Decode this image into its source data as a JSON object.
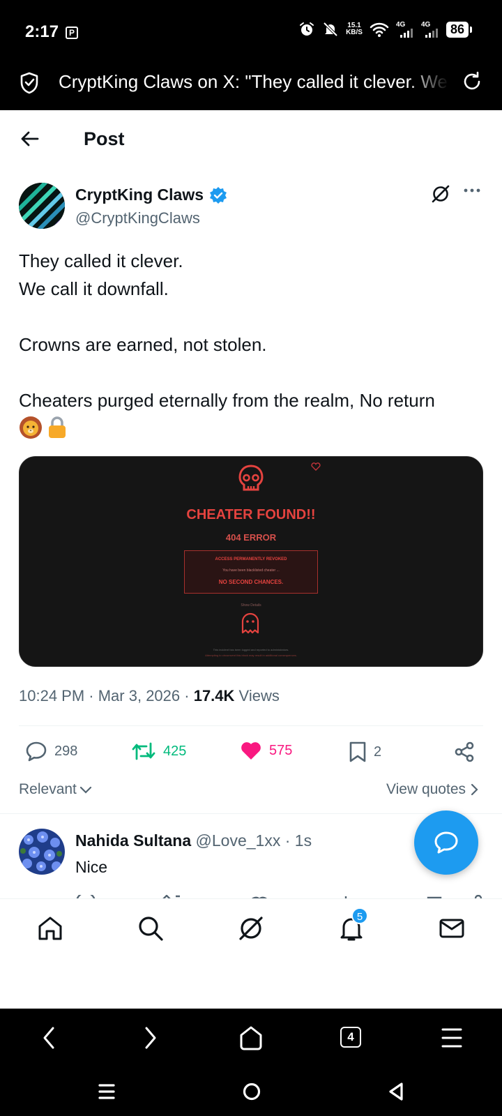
{
  "status_bar": {
    "time": "2:17",
    "p_badge": "P",
    "speed_top": "15.1",
    "speed_bottom": "KB/S",
    "net1": "4G",
    "net2": "4G",
    "battery": "86"
  },
  "browser": {
    "page_title": "CryptKing Claws on X: \"They called it clever. We call it downfall.",
    "tab_count": "4"
  },
  "header": {
    "title": "Post"
  },
  "tweet": {
    "author_name": "CryptKing Claws",
    "author_handle": "@CryptKingClaws",
    "lines": [
      "They called it clever.",
      "We call it downfall.",
      "",
      "Crowns are earned, not stolen.",
      "",
      "Cheaters purged eternally from the realm, No return"
    ],
    "emojis": [
      "🦁",
      "🔒"
    ],
    "media": {
      "title": "CHEATER FOUND!!",
      "subtitle": "404 ERROR",
      "box_line1": "ACCESS PERMANENTLY REVOKED",
      "box_line2": "You have been blacklisted cheater ...",
      "box_line3": "NO SECOND CHANCES.",
      "details": "Show Details",
      "footer1": "This incident has been logged and reported to administrators.",
      "footer2": "Attempting to circumvent this block may result in additional consequences."
    },
    "time": "10:24 PM",
    "date": "Mar 3, 2026",
    "views_count": "17.4K",
    "views_label": "Views",
    "stats": {
      "replies": "298",
      "reposts": "425",
      "likes": "575",
      "bookmarks": "2"
    },
    "sort_label": "Relevant",
    "view_quotes": "View quotes"
  },
  "reply": {
    "name": "Nahida Sultana",
    "handle": "@Love_1xx",
    "time": "· 1s",
    "text": "Nice"
  },
  "bottom_nav": {
    "notification_count": "5"
  },
  "colors": {
    "accent": "#1d9bf0",
    "repost": "#00ba7c",
    "like": "#f91880",
    "muted": "#536471",
    "cheater_red": "#e5433f"
  }
}
